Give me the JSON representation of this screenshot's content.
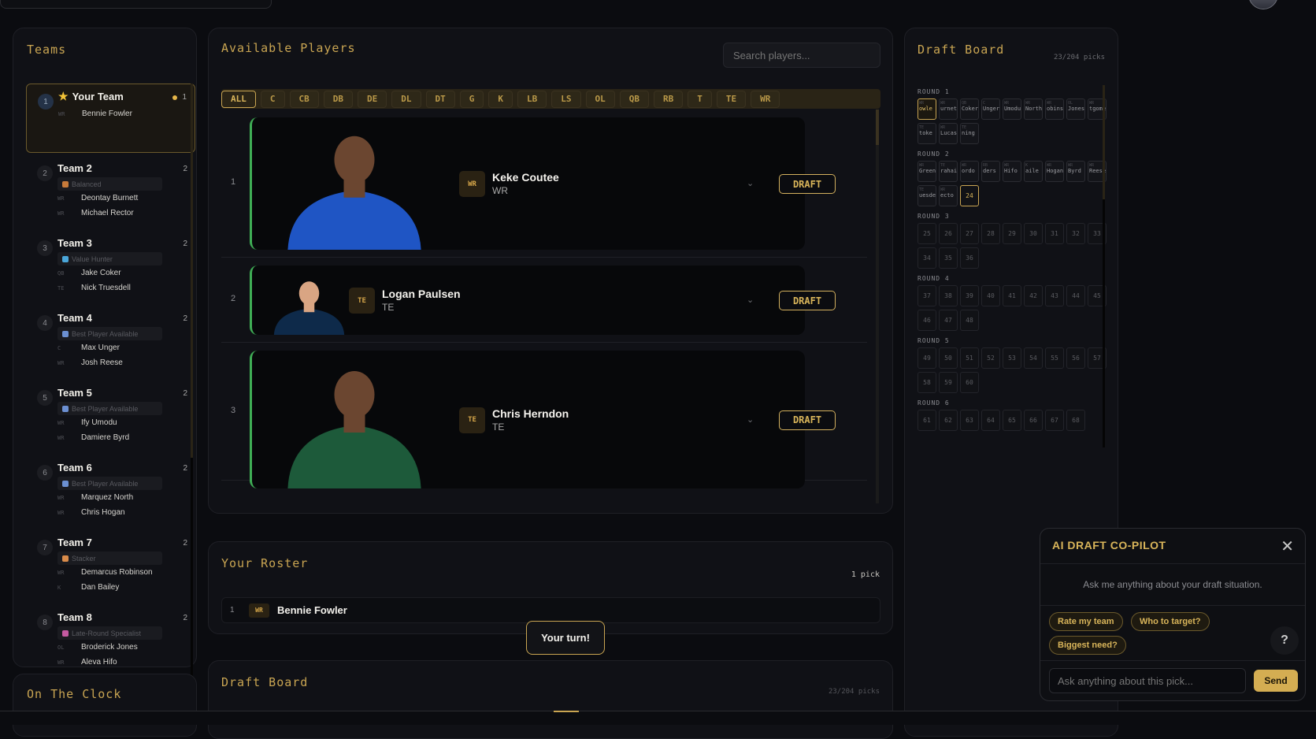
{
  "teams_panel": {
    "title": "Teams",
    "teams": [
      {
        "num": "1",
        "name": "Your Team",
        "count": "1",
        "strategy": "",
        "picks": [
          {
            "pos": "WR",
            "name": "Bennie Fowler"
          }
        ]
      },
      {
        "num": "2",
        "name": "Team 2",
        "count": "2",
        "strategy": "Balanced",
        "strategy_color": "#c77a3a",
        "picks": [
          {
            "pos": "WR",
            "name": "Deontay Burnett"
          },
          {
            "pos": "WR",
            "name": "Michael Rector"
          }
        ]
      },
      {
        "num": "3",
        "name": "Team 3",
        "count": "2",
        "strategy": "Value Hunter",
        "strategy_color": "#4aa6d9",
        "picks": [
          {
            "pos": "QB",
            "name": "Jake Coker"
          },
          {
            "pos": "TE",
            "name": "Nick Truesdell"
          }
        ]
      },
      {
        "num": "4",
        "name": "Team 4",
        "count": "2",
        "strategy": "Best Player Available",
        "strategy_color": "#6b8fd1",
        "picks": [
          {
            "pos": "C",
            "name": "Max Unger"
          },
          {
            "pos": "WR",
            "name": "Josh Reese"
          }
        ]
      },
      {
        "num": "5",
        "name": "Team 5",
        "count": "2",
        "strategy": "Best Player Available",
        "strategy_color": "#6b8fd1",
        "picks": [
          {
            "pos": "WR",
            "name": "Ify Umodu"
          },
          {
            "pos": "WR",
            "name": "Damiere Byrd"
          }
        ]
      },
      {
        "num": "6",
        "name": "Team 6",
        "count": "2",
        "strategy": "Best Player Available",
        "strategy_color": "#6b8fd1",
        "picks": [
          {
            "pos": "WR",
            "name": "Marquez North"
          },
          {
            "pos": "WR",
            "name": "Chris Hogan"
          }
        ]
      },
      {
        "num": "7",
        "name": "Team 7",
        "count": "2",
        "strategy": "Stacker",
        "strategy_color": "#d98b4a",
        "picks": [
          {
            "pos": "WR",
            "name": "Demarcus Robinson"
          },
          {
            "pos": "K",
            "name": "Dan Bailey"
          }
        ]
      },
      {
        "num": "8",
        "name": "Team 8",
        "count": "2",
        "strategy": "Late-Round Specialist",
        "strategy_color": "#c45aa0",
        "picks": [
          {
            "pos": "OL",
            "name": "Broderick Jones"
          },
          {
            "pos": "WR",
            "name": "Aleva Hifo"
          }
        ]
      }
    ]
  },
  "clock_panel": {
    "title": "On The Clock"
  },
  "available": {
    "title": "Available Players",
    "search_placeholder": "Search players...",
    "filters": [
      "ALL",
      "C",
      "CB",
      "DB",
      "DE",
      "DL",
      "DT",
      "G",
      "K",
      "LB",
      "LS",
      "OL",
      "QB",
      "RB",
      "T",
      "TE",
      "WR"
    ],
    "active_filter": "ALL",
    "draft_label": "DRAFT",
    "players": [
      {
        "rank": "1",
        "name": "Keke Coutee",
        "pos": "WR",
        "jersey": "#1f55c4"
      },
      {
        "rank": "2",
        "name": "Logan Paulsen",
        "pos": "TE",
        "jersey": "#0e2a4a"
      },
      {
        "rank": "3",
        "name": "Chris Herndon",
        "pos": "TE",
        "jersey": "#1d5a3a"
      }
    ]
  },
  "roster": {
    "title": "Your Roster",
    "count": "1 pick",
    "picks": [
      {
        "num": "1",
        "pos": "WR",
        "name": "Bennie Fowler"
      }
    ]
  },
  "toast": "Your turn!",
  "board_bottom": {
    "title": "Draft Board",
    "count": "23/204 picks"
  },
  "board": {
    "title": "Draft Board",
    "count": "23/204 picks",
    "rounds": [
      {
        "label": "ROUND 1",
        "cells": [
          {
            "pos": "WR",
            "name": "owle",
            "mine": true
          },
          {
            "pos": "WR",
            "name": "urnet"
          },
          {
            "pos": "QB",
            "name": "Coker"
          },
          {
            "pos": "C",
            "name": "Unger"
          },
          {
            "pos": "WR",
            "name": "Umodu"
          },
          {
            "pos": "WR",
            "name": "North"
          },
          {
            "pos": "WR",
            "name": "obinso"
          },
          {
            "pos": "OL",
            "name": "Jones"
          },
          {
            "pos": "WR",
            "name": "tgome"
          },
          {
            "pos": "TE",
            "name": "toke"
          },
          {
            "pos": "WR",
            "name": "Lucas"
          },
          {
            "pos": "TE",
            "name": "ning"
          }
        ]
      },
      {
        "label": "ROUND 2",
        "cells": [
          {
            "pos": "WR",
            "name": "Green"
          },
          {
            "pos": "TE",
            "name": "rahai"
          },
          {
            "pos": "WR",
            "name": "ordo"
          },
          {
            "pos": "RB",
            "name": "ders"
          },
          {
            "pos": "WR",
            "name": "Hifo"
          },
          {
            "pos": "K",
            "name": "aile"
          },
          {
            "pos": "WR",
            "name": "Hogan"
          },
          {
            "pos": "WR",
            "name": "Byrd"
          },
          {
            "pos": "WR",
            "name": "Reese"
          },
          {
            "pos": "TE",
            "name": "uesde"
          },
          {
            "pos": "WR",
            "name": "ecto"
          },
          {
            "num": "24",
            "current": true
          }
        ]
      },
      {
        "label": "ROUND 3",
        "cells": [
          {
            "num": "25"
          },
          {
            "num": "26"
          },
          {
            "num": "27"
          },
          {
            "num": "28"
          },
          {
            "num": "29"
          },
          {
            "num": "30"
          },
          {
            "num": "31"
          },
          {
            "num": "32"
          },
          {
            "num": "33"
          },
          {
            "num": "34"
          },
          {
            "num": "35"
          },
          {
            "num": "36"
          }
        ]
      },
      {
        "label": "ROUND 4",
        "cells": [
          {
            "num": "37"
          },
          {
            "num": "38"
          },
          {
            "num": "39"
          },
          {
            "num": "40"
          },
          {
            "num": "41"
          },
          {
            "num": "42"
          },
          {
            "num": "43"
          },
          {
            "num": "44"
          },
          {
            "num": "45"
          },
          {
            "num": "46"
          },
          {
            "num": "47"
          },
          {
            "num": "48"
          }
        ]
      },
      {
        "label": "ROUND 5",
        "cells": [
          {
            "num": "49"
          },
          {
            "num": "50"
          },
          {
            "num": "51"
          },
          {
            "num": "52"
          },
          {
            "num": "53"
          },
          {
            "num": "54"
          },
          {
            "num": "55"
          },
          {
            "num": "56"
          },
          {
            "num": "57"
          },
          {
            "num": "58"
          },
          {
            "num": "59"
          },
          {
            "num": "60"
          }
        ]
      },
      {
        "label": "ROUND 6",
        "cells": [
          {
            "num": "61"
          },
          {
            "num": "62"
          },
          {
            "num": "63"
          },
          {
            "num": "64"
          },
          {
            "num": "65"
          },
          {
            "num": "66"
          },
          {
            "num": "67"
          },
          {
            "num": "68"
          }
        ]
      }
    ]
  },
  "copilot": {
    "title": "AI DRAFT CO-PILOT",
    "prompt": "Ask me anything about your draft situation.",
    "chips": [
      "Rate my team",
      "Who to target?",
      "Biggest need?"
    ],
    "input_placeholder": "Ask anything about this pick...",
    "send_label": "Send",
    "help": "?"
  }
}
